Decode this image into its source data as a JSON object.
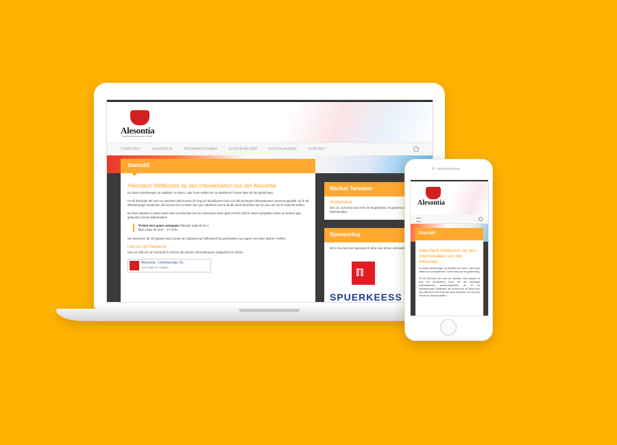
{
  "site": {
    "logo_text": "Alesontia",
    "logo_subtitle": "Lëtzebuerger Studenten zu Bonn",
    "nav": [
      "STARTSÄIT",
      "ALESONTIA",
      "INFORMATIOUNEN",
      "STUDIEFÄCHER",
      "FOTOSGALERIE",
      "KONTAKT"
    ],
    "page_title": "Startsäit",
    "welcome_heading": "Häerzlech Wëllkomm op den Internetsäiten vun der Alesontia.",
    "intro": "Du bass Lëtzebuerger an studéiers zu Bonn, oder hues wëlles hei ze studéieren? Dann bass de hei goldrichteg.",
    "para2": "Fir all d'Schüler déi sech an nächster Zäit mussen fir eng Uni decidéieren hunn mir déi wichtegst Informatiounen zesummegestellt, an fir all d'lëtzebuerger Studenten déi schonn hei zu Bonn sinn (an natierlech och fir all déi aner) berichten mir hei wou mir eis fir d'nächst treffen.",
    "para3": "Du bass Student zu Bonn awer nach net Member bei der Alesontia? Dann gëtt et héich Zäit fir eisem sympathe-schen an ëmmer gutt gelaunten Cercle bäizetrieden!",
    "quote_text": "\"Potius sero quam numquam.\"",
    "quote_translation": "(Besser spät als nie.)",
    "quote_source": "Titus Livius 59 vChr – 17 vChr.",
    "para4": "Mir wënschen dir vill Spaass beim Liesen an Stöberen an hoffentlech bis geschwënn op engem vun eisen aktiven Treffen.",
    "facebook_heading": "Like eis op Facebook",
    "facebook_text": "Like eis Säit elo op Facebook fir ëmmer déi neisten Informatiounen matgedeelt ze kréien.",
    "facebook_page_name": "Alesontia - Lëtzebuerger St...",
    "facebook_likes": "146 „Gefällt mir\"-Angaben",
    "sidebar_terminer_title": "Nächst Terminer",
    "event_name": "Studentebal",
    "event_text": "Den 22. Juli 2016 ass erëm de Studentebal. Et gewinnt ob der Wiss beim P&R Bouillon.",
    "sidebar_sponsoring_title": "Sponsoring",
    "sponsor_text": "Mir si frou lech eis Sponsors fir dëst Joer kënne virzestellen:",
    "sponsor_name": "SPUERKEESS"
  },
  "phone": {
    "logo_text": "Alesontia",
    "page_title": "Startsäit",
    "welcome_heading": "Häerzlech Wëllkomm op den Internetsäiten vun der Alesontia.",
    "intro": "Du bass Lëtzebuerger an studéiers zu Bonn, oder hues wëlles hei ze studéieren? Dann bass de hei goldrichteg.",
    "para2": "Fir all d'Schüler déi sech an nächster Zäit mussen fir eng Uni decidéieren hunn mir déi wichtegst Informatiounen zesummegestellt, an fir all d'lëtzebuerger Studenten déi schonn hei zu Bonn sinn (an natierlech och fir all déi aner) berichten mir hei wou mir eis fir d'nächst treffen."
  },
  "colors": {
    "background": "#FFB300",
    "accent": "#FFA830",
    "heading": "#FF9E1B",
    "dark_panel": "#3b3b3b"
  }
}
